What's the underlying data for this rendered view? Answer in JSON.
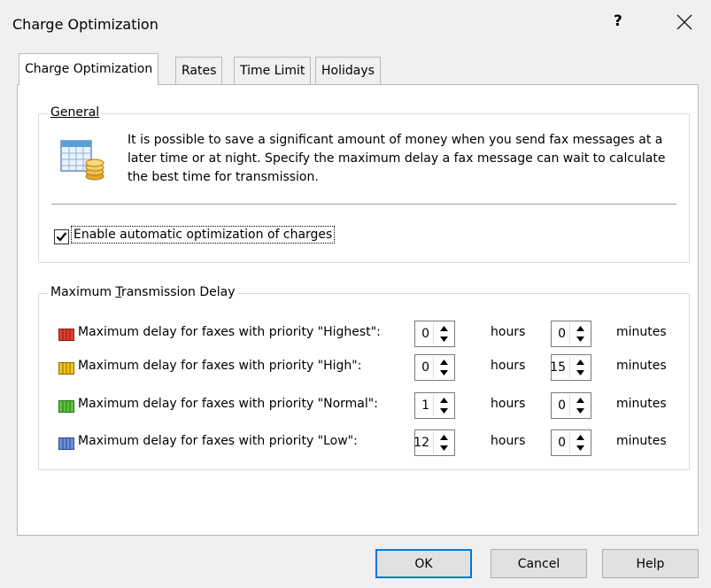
{
  "window": {
    "title": "Charge Optimization",
    "help_label": "?"
  },
  "tabs": [
    {
      "label": "Charge Optimization",
      "active": true
    },
    {
      "label": "Rates",
      "active": false
    },
    {
      "label": "Time Limit",
      "active": false
    },
    {
      "label": "Holidays",
      "active": false
    }
  ],
  "general": {
    "legend": "General",
    "description": "It is possible to save a significant amount of money when you send fax messages at a later time or at night. Specify the maximum delay a fax message can wait to calculate the best time for transmission.",
    "icon": "calendar-coins-icon",
    "enable_checkbox": {
      "label": "Enable automatic optimization of charges",
      "checked": true
    }
  },
  "delay": {
    "legend_pre": "Maximum ",
    "legend_accel": "T",
    "legend_post": "ransmission Delay",
    "hours_unit": "hours",
    "minutes_unit": "minutes",
    "rows": [
      {
        "label": "Maximum delay for faxes with priority \"Highest\":",
        "hours": "0",
        "minutes": "0",
        "color": "#e03c2c"
      },
      {
        "label": "Maximum delay for faxes with priority \"High\":",
        "hours": "0",
        "minutes": "15",
        "color": "#f2c418"
      },
      {
        "label": "Maximum delay for faxes with priority \"Normal\":",
        "hours": "1",
        "minutes": "0",
        "color": "#5cc43c"
      },
      {
        "label": "Maximum delay for faxes with priority \"Low\":",
        "hours": "12",
        "minutes": "0",
        "color": "#6b8fd6"
      }
    ]
  },
  "buttons": {
    "ok": "OK",
    "cancel": "Cancel",
    "help": "Help"
  }
}
